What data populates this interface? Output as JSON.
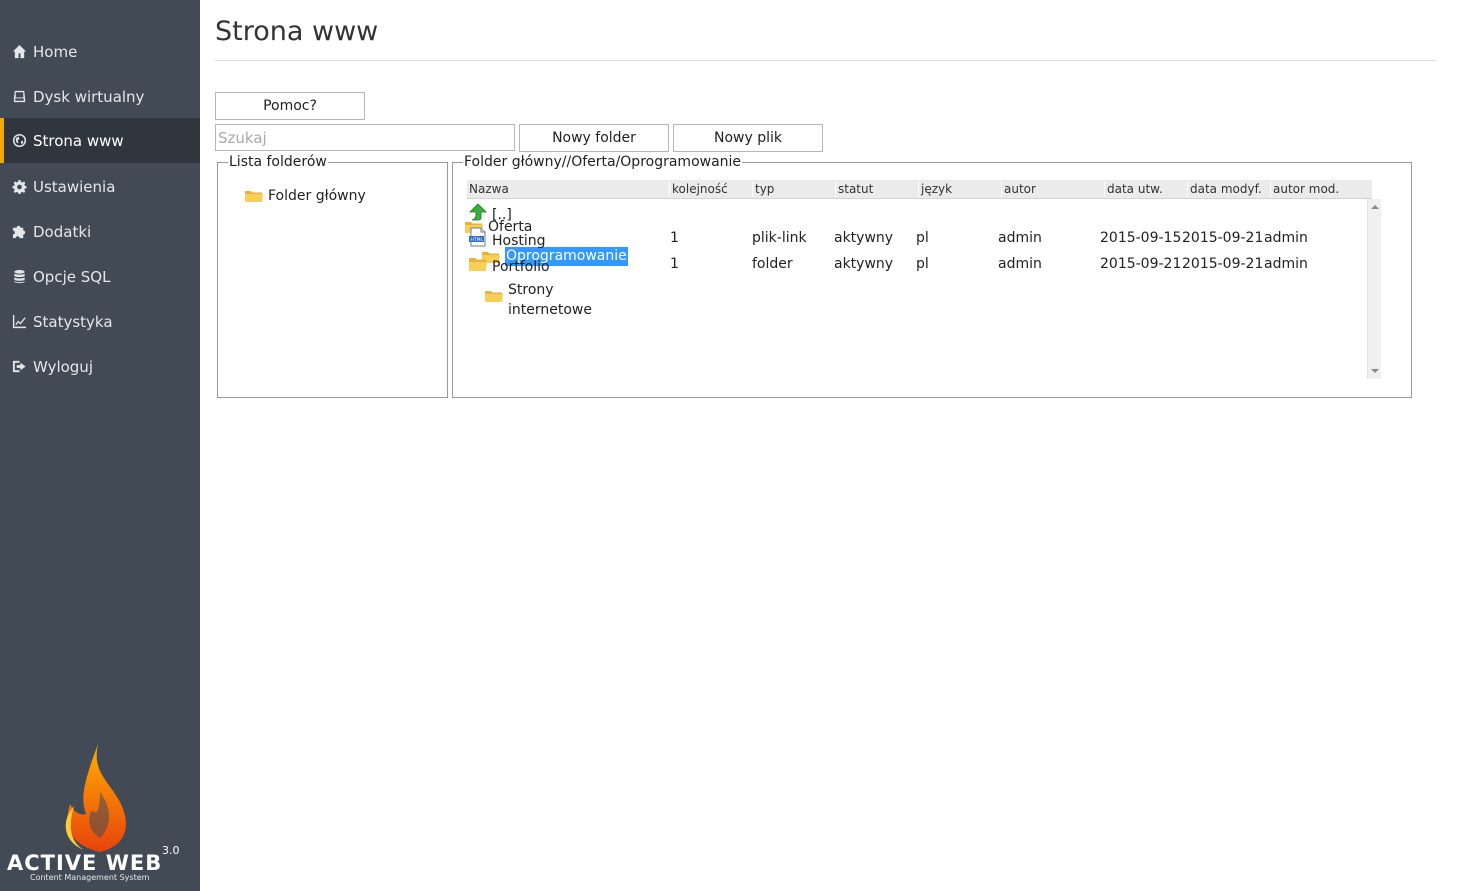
{
  "sidebar": {
    "items": [
      {
        "label": "Home",
        "icon": "home-icon"
      },
      {
        "label": "Dysk wirtualny",
        "icon": "hdd-icon"
      },
      {
        "label": "Strona www",
        "icon": "globe-icon",
        "active": true
      },
      {
        "label": "Ustawienia",
        "icon": "gear-icon"
      },
      {
        "label": "Dodatki",
        "icon": "puzzle-icon"
      },
      {
        "label": "Opcje SQL",
        "icon": "database-icon"
      },
      {
        "label": "Statystyka",
        "icon": "chart-icon"
      },
      {
        "label": "Wyloguj",
        "icon": "logout-icon"
      }
    ],
    "logo": {
      "name": "ACTIVE WEB",
      "version": "3.0",
      "tagline": "Content Management System"
    }
  },
  "colors": {
    "sidebar_bg": "#424b55",
    "active_bg": "#2f363e",
    "accent": "#f2a900",
    "selection": "#3399ff"
  },
  "page": {
    "title": "Strona www"
  },
  "toolbar": {
    "help_label": "Pomoc?",
    "search_placeholder": "Szukaj",
    "new_folder_label": "Nowy folder",
    "new_file_label": "Nowy plik"
  },
  "tree": {
    "legend": "Lista folderów",
    "nodes": [
      {
        "label": "Folder główny"
      },
      {
        "label": "Oferta"
      },
      {
        "label": "Oprogramowanie",
        "selected": true
      },
      {
        "label_line1": "Strony",
        "label_line2": "internetowe"
      }
    ]
  },
  "files": {
    "legend": "Folder główny//Oferta/Oprogramowanie",
    "columns": [
      "Nazwa",
      "kolejność",
      "typ",
      "statut",
      "język",
      "autor",
      "data utw.",
      "data modyf.",
      "autor mod."
    ],
    "up_label": "[..]",
    "rows": [
      {
        "icon": "html-file-icon",
        "name": "Hosting",
        "order": "1",
        "type": "plik-link",
        "status": "aktywny",
        "lang": "pl",
        "author": "admin",
        "created": "2015-09-15",
        "modified": "2015-09-21",
        "mod_author": "admin"
      },
      {
        "icon": "folder-icon",
        "name": "Portfolio",
        "order": "1",
        "type": "folder",
        "status": "aktywny",
        "lang": "pl",
        "author": "admin",
        "created": "2015-09-21",
        "modified": "2015-09-21",
        "mod_author": "admin"
      }
    ]
  }
}
